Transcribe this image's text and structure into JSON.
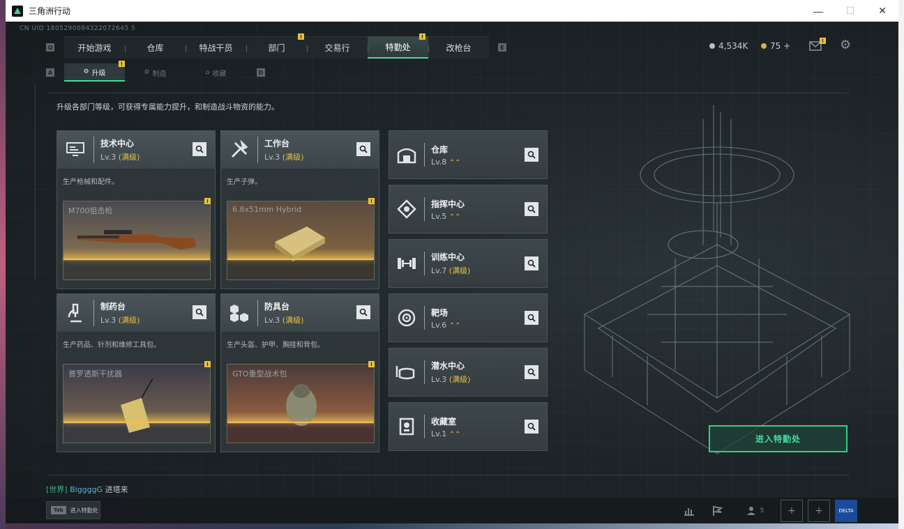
{
  "window": {
    "title": "三角洲行动",
    "minimize": "—",
    "maximize": "☐",
    "close": "✕"
  },
  "uid": "CN UID 1805290084322072645 5",
  "keys": {
    "q": "Q",
    "e": "E",
    "a": "A",
    "d": "D"
  },
  "nav": {
    "tabs": [
      {
        "label": "开始游戏"
      },
      {
        "label": "仓库"
      },
      {
        "label": "特战干员"
      },
      {
        "label": "部门",
        "badge": "!"
      },
      {
        "label": "交易行"
      },
      {
        "label": "特勤处",
        "badge": "!",
        "active": true
      },
      {
        "label": "改枪台"
      }
    ]
  },
  "currency": {
    "silver": "4,534K",
    "gold": "75 +"
  },
  "header_icons": {
    "mail": "mail-icon",
    "settings": "gear-icon",
    "mail_badge": "!"
  },
  "subnav": {
    "tabs": [
      {
        "label": "升级",
        "badge": "!",
        "active": true,
        "icon": "⚙"
      },
      {
        "label": "制造",
        "icon": "⚙"
      },
      {
        "label": "收藏",
        "icon": "⌂"
      }
    ]
  },
  "description": "升级各部门等级，可获得专属能力提升，和制造战斗物资的能力。",
  "cards": [
    {
      "name": "技术中心",
      "level": "Lv.3",
      "max": "(满级)",
      "sub": "生产枪械和配件。",
      "item": "M700狙击枪",
      "icon": "monitor-icon"
    },
    {
      "name": "工作台",
      "level": "Lv.3",
      "max": "(满级)",
      "sub": "生产子弹。",
      "item": "6.8x51mm Hybrid",
      "icon": "tools-icon"
    },
    {
      "name": "制药台",
      "level": "Lv.3",
      "max": "(满级)",
      "sub": "生产药品、针剂和维修工具包。",
      "item": "普罗透斯干扰器",
      "icon": "microscope-icon"
    },
    {
      "name": "防具台",
      "level": "Lv.3",
      "max": "(满级)",
      "sub": "生产头盔、护甲、胸挂和背包。",
      "item": "GTO重型战术包",
      "icon": "cubes-icon"
    }
  ],
  "rows": [
    {
      "name": "仓库",
      "level": "Lv.8",
      "upgrade": "⌃⌃",
      "icon": "warehouse-icon"
    },
    {
      "name": "指挥中心",
      "level": "Lv.5",
      "upgrade": "⌃⌃",
      "icon": "command-icon"
    },
    {
      "name": "训练中心",
      "level": "Lv.7",
      "max": "(满级)",
      "icon": "dumbbell-icon"
    },
    {
      "name": "靶场",
      "level": "Lv.6",
      "upgrade": "⌃⌃",
      "icon": "target-icon"
    },
    {
      "name": "潜水中心",
      "level": "Lv.3",
      "max": "(满级)",
      "icon": "diving-mask-icon"
    },
    {
      "name": "收藏室",
      "level": "Lv.1",
      "upgrade": "⌃⌃",
      "icon": "trophy-icon"
    }
  ],
  "enter_button": "进入特勤处",
  "chat": {
    "channel": "[世界]",
    "player": "BiggggG",
    "message": "进塔来"
  },
  "tab_hint": {
    "key": "Tab",
    "label": "进入特勤处"
  },
  "bottom": {
    "friends_count": "5",
    "logo": "DELTA"
  },
  "colors": {
    "accent": "#3fe0a0",
    "badge": "#e8c040",
    "max_level": "#e8c040"
  }
}
